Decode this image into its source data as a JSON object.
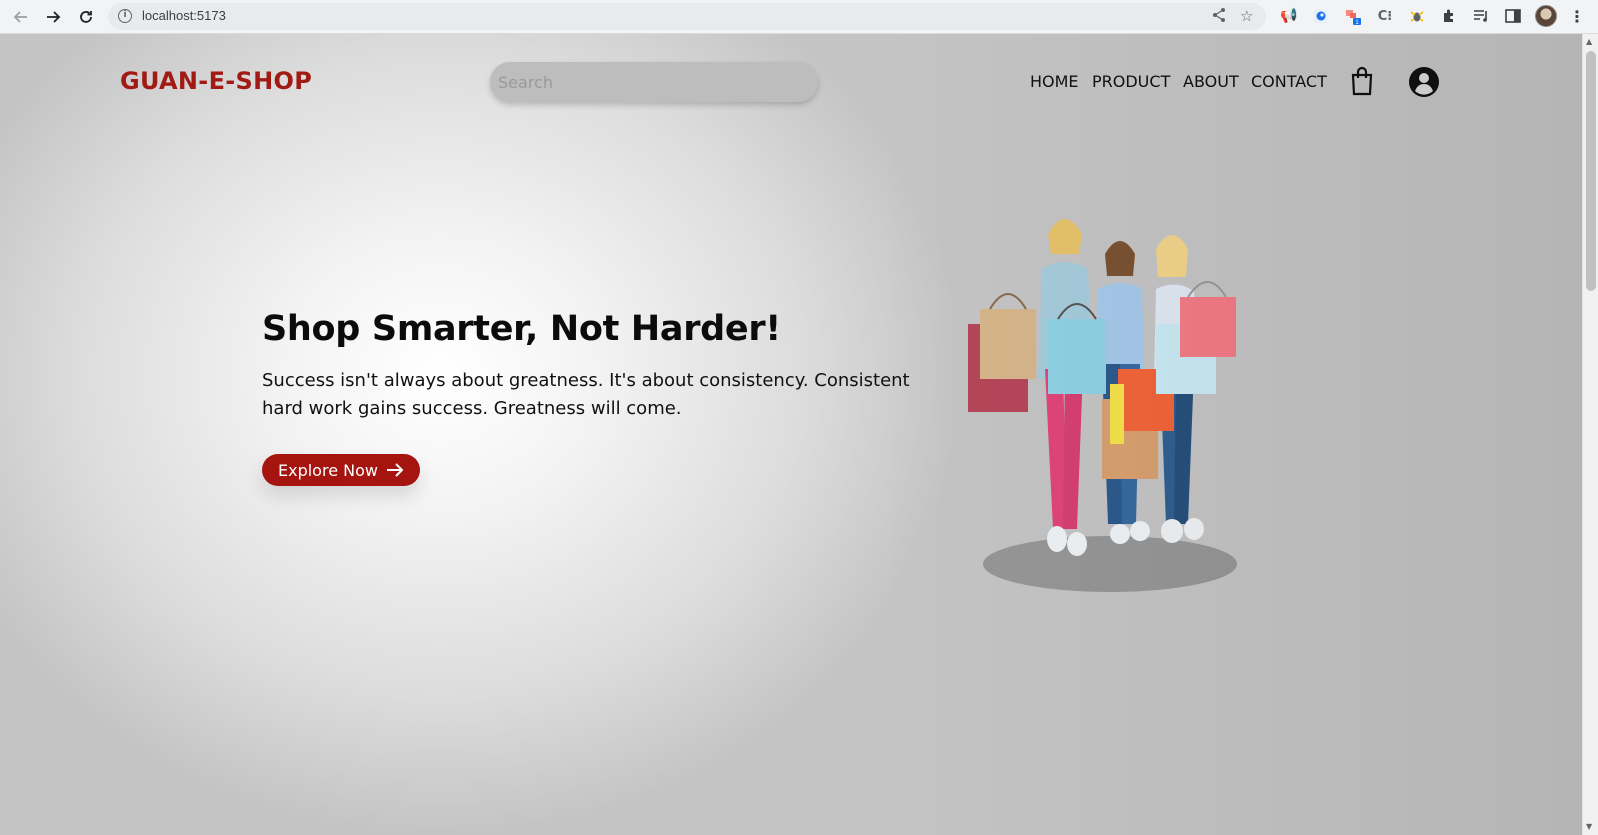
{
  "browser": {
    "url": "localhost:5173",
    "icons": [
      "back-arrow-icon",
      "forward-arrow-icon",
      "reload-icon",
      "site-info-icon",
      "share-icon",
      "bookmark-star-icon",
      "extensions-icon",
      "reading-list-icon",
      "side-panel-icon",
      "profile-avatar-icon",
      "menu-kebab-icon"
    ],
    "extension_badge": "1"
  },
  "header": {
    "brand": "GUAN-E-SHOP",
    "search_placeholder": "Search",
    "nav": [
      "HOME",
      "PRODUCT",
      "ABOUT",
      "CONTACT"
    ]
  },
  "hero": {
    "title": "Shop Smarter, Not Harder!",
    "subtitle": "Success isn't always about greatness. It's about consistency. Consistent hard work gains success. Greatness will come.",
    "cta_label": "Explore Now"
  },
  "colors": {
    "brand": "#a11a14",
    "button": "#a5140f",
    "search_bg": "#bdbdbd"
  }
}
